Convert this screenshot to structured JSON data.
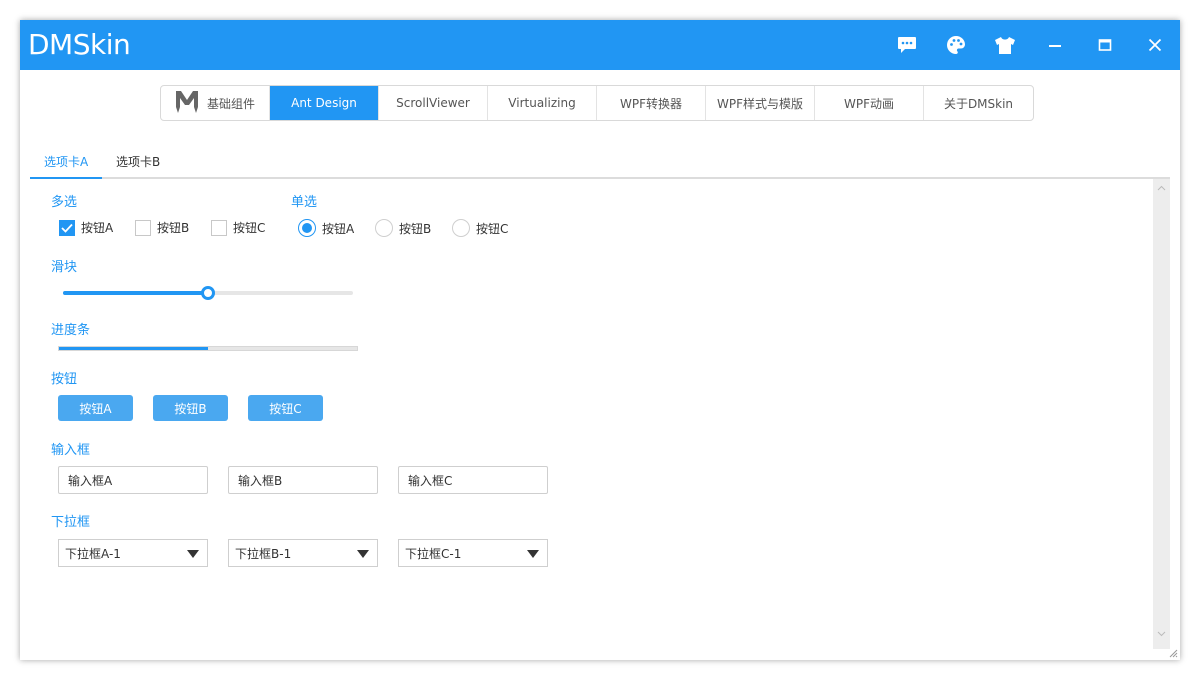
{
  "app": {
    "title": "DMSkin"
  },
  "titlebar_icons": [
    "message-icon",
    "palette-icon",
    "shirt-icon",
    "minimize-icon",
    "maximize-icon",
    "close-icon"
  ],
  "nav": {
    "items": [
      {
        "label": "基础组件",
        "active": false
      },
      {
        "label": "Ant Design",
        "active": true
      },
      {
        "label": "ScrollViewer",
        "active": false
      },
      {
        "label": "Virtualizing",
        "active": false
      },
      {
        "label": "WPF转换器",
        "active": false
      },
      {
        "label": "WPF样式与模版",
        "active": false
      },
      {
        "label": "WPF动画",
        "active": false
      },
      {
        "label": "关于DMSkin",
        "active": false
      }
    ]
  },
  "tabs": [
    {
      "label": "选项卡A",
      "active": true
    },
    {
      "label": "选项卡B",
      "active": false
    }
  ],
  "sections": {
    "multi": {
      "label": "多选",
      "options": [
        {
          "label": "按钮A",
          "checked": true
        },
        {
          "label": "按钮B",
          "checked": false
        },
        {
          "label": "按钮C",
          "checked": false
        }
      ]
    },
    "single": {
      "label": "单选",
      "options": [
        {
          "label": "按钮A",
          "checked": true
        },
        {
          "label": "按钮B",
          "checked": false
        },
        {
          "label": "按钮C",
          "checked": false
        }
      ]
    },
    "slider": {
      "label": "滑块",
      "value": 0.5
    },
    "progress": {
      "label": "进度条",
      "value": 0.5
    },
    "buttons": {
      "label": "按钮",
      "items": [
        "按钮A",
        "按钮B",
        "按钮C"
      ]
    },
    "inputs": {
      "label": "输入框",
      "values": [
        "输入框A",
        "输入框B",
        "输入框C"
      ]
    },
    "selects": {
      "label": "下拉框",
      "values": [
        "下拉框A-1",
        "下拉框B-1",
        "下拉框C-1"
      ]
    }
  },
  "colors": {
    "accent": "#2196f3",
    "button": "#4aa8f0"
  }
}
